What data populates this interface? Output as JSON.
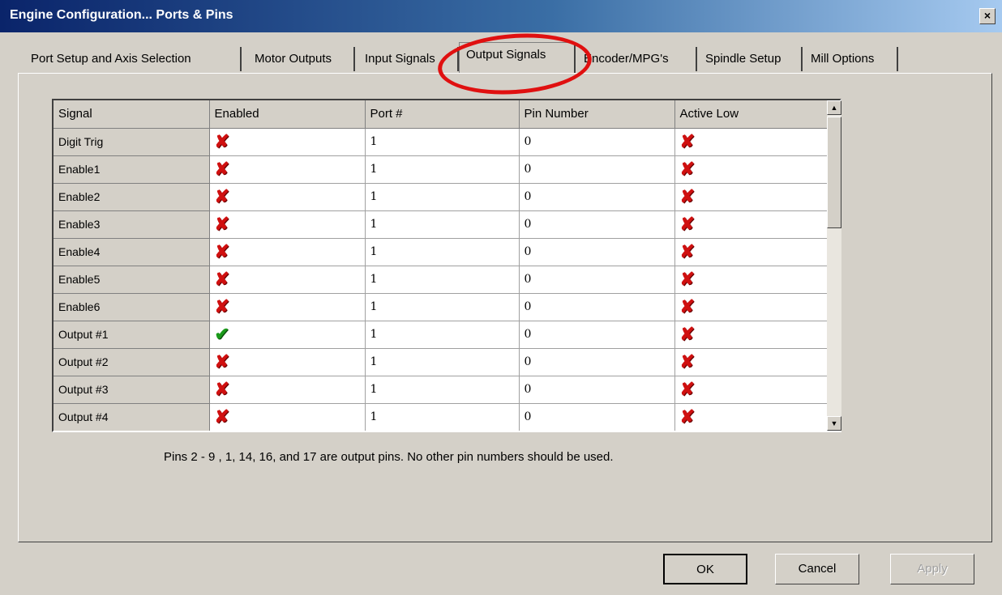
{
  "window": {
    "title": "Engine Configuration... Ports & Pins",
    "close_label": "×"
  },
  "tabs": [
    {
      "label": "Port Setup and Axis Selection"
    },
    {
      "label": "Motor Outputs"
    },
    {
      "label": "Input Signals"
    },
    {
      "label": "Output Signals",
      "active": true
    },
    {
      "label": "Encoder/MPG's"
    },
    {
      "label": "Spindle Setup"
    },
    {
      "label": "Mill Options"
    }
  ],
  "grid": {
    "columns": [
      "Signal",
      "Enabled",
      "Port #",
      "Pin Number",
      "Active Low"
    ],
    "rows": [
      {
        "signal": "Digit Trig",
        "enabled": "✘",
        "port": "1",
        "pin": "0",
        "active_low": "✘"
      },
      {
        "signal": "Enable1",
        "enabled": "✘",
        "port": "1",
        "pin": "0",
        "active_low": "✘"
      },
      {
        "signal": "Enable2",
        "enabled": "✘",
        "port": "1",
        "pin": "0",
        "active_low": "✘"
      },
      {
        "signal": "Enable3",
        "enabled": "✘",
        "port": "1",
        "pin": "0",
        "active_low": "✘"
      },
      {
        "signal": "Enable4",
        "enabled": "✘",
        "port": "1",
        "pin": "0",
        "active_low": "✘"
      },
      {
        "signal": "Enable5",
        "enabled": "✘",
        "port": "1",
        "pin": "0",
        "active_low": "✘"
      },
      {
        "signal": "Enable6",
        "enabled": "✘",
        "port": "1",
        "pin": "0",
        "active_low": "✘"
      },
      {
        "signal": "Output #1",
        "enabled": "✔",
        "port": "1",
        "pin": "0",
        "active_low": "✘"
      },
      {
        "signal": "Output #2",
        "enabled": "✘",
        "port": "1",
        "pin": "0",
        "active_low": "✘"
      },
      {
        "signal": "Output #3",
        "enabled": "✘",
        "port": "1",
        "pin": "0",
        "active_low": "✘"
      },
      {
        "signal": "Output #4",
        "enabled": "✘",
        "port": "1",
        "pin": "0",
        "active_low": "✘"
      }
    ]
  },
  "scrollbar": {
    "up_icon": "triangle-up-icon",
    "down_icon": "triangle-down-icon",
    "up_glyph": "▲",
    "down_glyph": "▼"
  },
  "note": "Pins 2 - 9 , 1, 14, 16, and 17 are output pins. No  other pin numbers should be used.",
  "buttons": {
    "ok": "OK",
    "cancel": "Cancel",
    "apply": "Apply"
  },
  "colors": {
    "disabled_mark": "#d01010",
    "enabled_mark": "#1a9a1a",
    "annotation_circle": "#e01010"
  }
}
